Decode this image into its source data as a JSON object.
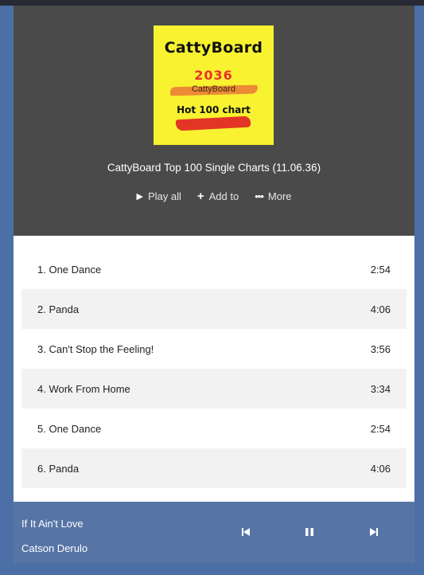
{
  "album": {
    "cover": {
      "brand": "CattyBoard",
      "year": "2036",
      "subtitle": "CattyBoard",
      "chart_label": "Hot 100 chart"
    },
    "title": "CattyBoard Top 100 Single Charts (11.06.36)"
  },
  "actions": {
    "play_all": "Play all",
    "add_to": "Add to",
    "more": "More"
  },
  "tracks": [
    {
      "label": "1. One Dance",
      "duration": "2:54"
    },
    {
      "label": "2. Panda",
      "duration": "4:06"
    },
    {
      "label": "3. Can't Stop the Feeling!",
      "duration": "3:56"
    },
    {
      "label": "4. Work From Home",
      "duration": "3:34"
    },
    {
      "label": "5. One Dance",
      "duration": "2:54"
    },
    {
      "label": "6. Panda",
      "duration": "4:06"
    }
  ],
  "player": {
    "song": "If It Ain't Love",
    "artist": "Catson Derulo",
    "icons": [
      "previous-icon",
      "pause-icon",
      "next-icon"
    ]
  },
  "colors": {
    "background": "#4b6fa6",
    "header": "#4a4a4a",
    "cover": "#f8f230",
    "accent_red": "#e33525",
    "player_bar": "#5675a5"
  }
}
